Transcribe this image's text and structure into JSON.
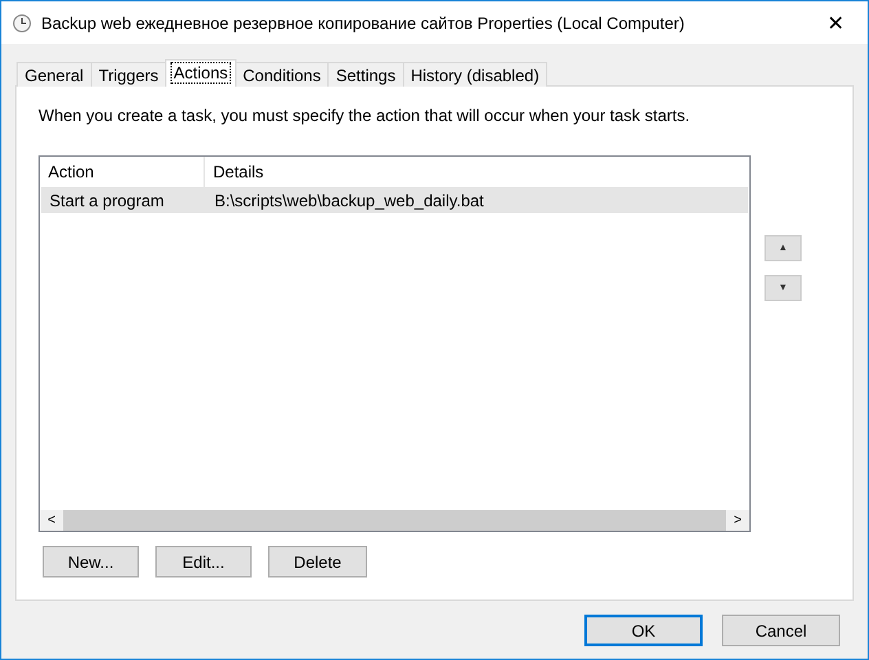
{
  "window": {
    "title": "Backup web ежедневное резервное копирование сайтов Properties (Local Computer)",
    "close": "✕"
  },
  "tabs": [
    {
      "label": "General",
      "selected": false
    },
    {
      "label": "Triggers",
      "selected": false
    },
    {
      "label": "Actions",
      "selected": true
    },
    {
      "label": "Conditions",
      "selected": false
    },
    {
      "label": "Settings",
      "selected": false
    },
    {
      "label": "History (disabled)",
      "selected": false
    }
  ],
  "description": "When you create a task, you must specify the action that will occur when your task starts.",
  "table": {
    "columns": [
      "Action",
      "Details"
    ],
    "rows": [
      {
        "cells": [
          "Start a program",
          "B:\\scripts\\web\\backup_web_daily.bat"
        ],
        "selected": true
      }
    ]
  },
  "scroll": {
    "left": "<",
    "right": ">"
  },
  "order_buttons": [
    "▲",
    "▼"
  ],
  "action_buttons": [
    "New...",
    "Edit...",
    "Delete"
  ],
  "dialog_buttons": [
    {
      "label": "OK",
      "default": true
    },
    {
      "label": "Cancel",
      "default": false
    }
  ]
}
